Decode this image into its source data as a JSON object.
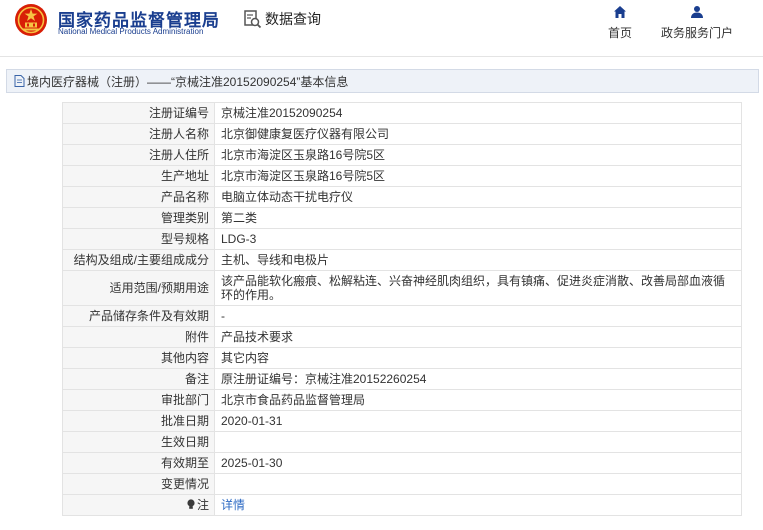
{
  "header": {
    "brand_cn": "国家药品监督管理局",
    "brand_en": "National Medical Products Administration",
    "search_title": "数据查询",
    "nav": [
      {
        "label": "首页",
        "icon": "home-icon"
      },
      {
        "label": "政务服务门户",
        "icon": "user-icon"
      }
    ]
  },
  "breadcrumb": {
    "text": "境内医疗器械（注册）——“京械注准20152090254”基本信息"
  },
  "record": [
    {
      "label": "注册证编号",
      "value": "京械注准20152090254"
    },
    {
      "label": "注册人名称",
      "value": "北京御健康复医疗仪器有限公司"
    },
    {
      "label": "注册人住所",
      "value": "北京市海淀区玉泉路16号院5区"
    },
    {
      "label": "生产地址",
      "value": "北京市海淀区玉泉路16号院5区"
    },
    {
      "label": "产品名称",
      "value": "电脑立体动态干扰电疗仪"
    },
    {
      "label": "管理类别",
      "value": "第二类"
    },
    {
      "label": "型号规格",
      "value": "LDG-3"
    },
    {
      "label": "结构及组成/主要组成成分",
      "value": "主机、导线和电极片"
    },
    {
      "label": "适用范围/预期用途",
      "value": "该产品能软化瘢痕、松解粘连、兴奋神经肌肉组织，具有镇痛、促进炎症消散、改善局部血液循环的作用。"
    },
    {
      "label": "产品储存条件及有效期",
      "value": "-"
    },
    {
      "label": "附件",
      "value": "产品技术要求"
    },
    {
      "label": "其他内容",
      "value": "其它内容"
    },
    {
      "label": "备注",
      "value": "原注册证编号：京械注准20152260254"
    },
    {
      "label": "审批部门",
      "value": "北京市食品药品监督管理局"
    },
    {
      "label": "批准日期",
      "value": "2020-01-31"
    },
    {
      "label": "生效日期",
      "value": ""
    },
    {
      "label": "有效期至",
      "value": "2025-01-30"
    },
    {
      "label": "变更情况",
      "value": ""
    },
    {
      "label": "注",
      "value": "详情"
    }
  ],
  "colors": {
    "brand": "#1a3e8f",
    "link": "#2e6bc4",
    "label_bg": "#f6f6f6",
    "title_bg": "#eef2f8"
  }
}
